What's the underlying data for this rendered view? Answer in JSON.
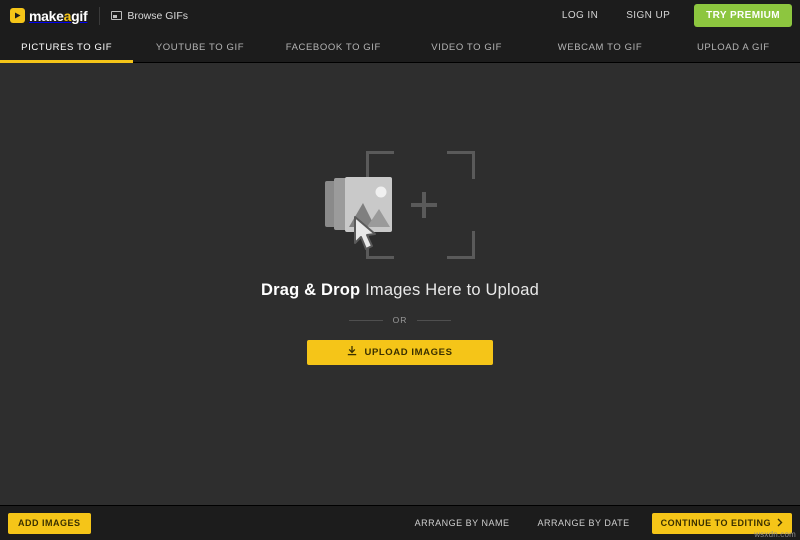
{
  "topbar": {
    "logo_text_main": "make",
    "logo_text_accent": "a",
    "logo_text_end": "gif",
    "browse_label": "Browse GIFs",
    "login_label": "LOG IN",
    "signup_label": "SIGN UP",
    "premium_label": "TRY PREMIUM"
  },
  "nav": {
    "tabs": [
      {
        "label": "PICTURES TO GIF",
        "active": true
      },
      {
        "label": "YOUTUBE TO GIF",
        "active": false
      },
      {
        "label": "FACEBOOK TO GIF",
        "active": false
      },
      {
        "label": "VIDEO TO GIF",
        "active": false
      },
      {
        "label": "WEBCAM TO GIF",
        "active": false
      },
      {
        "label": "UPLOAD A GIF",
        "active": false
      }
    ]
  },
  "main": {
    "drop_title_bold": "Drag & Drop",
    "drop_title_rest": " Images Here to Upload",
    "or_label": "OR",
    "upload_button_label": "UPLOAD IMAGES"
  },
  "bottombar": {
    "add_images_label": "ADD IMAGES",
    "arrange_by_name_label": "ARRANGE BY NAME",
    "arrange_by_date_label": "ARRANGE BY DATE",
    "continue_label": "CONTINUE TO EDITING",
    "watermark": "wsxdn.com"
  },
  "colors": {
    "accent": "#f5c518",
    "premium_green": "#8dc63f",
    "bar_bg": "#1c1c1c",
    "canvas_bg": "#2e2e2e"
  }
}
